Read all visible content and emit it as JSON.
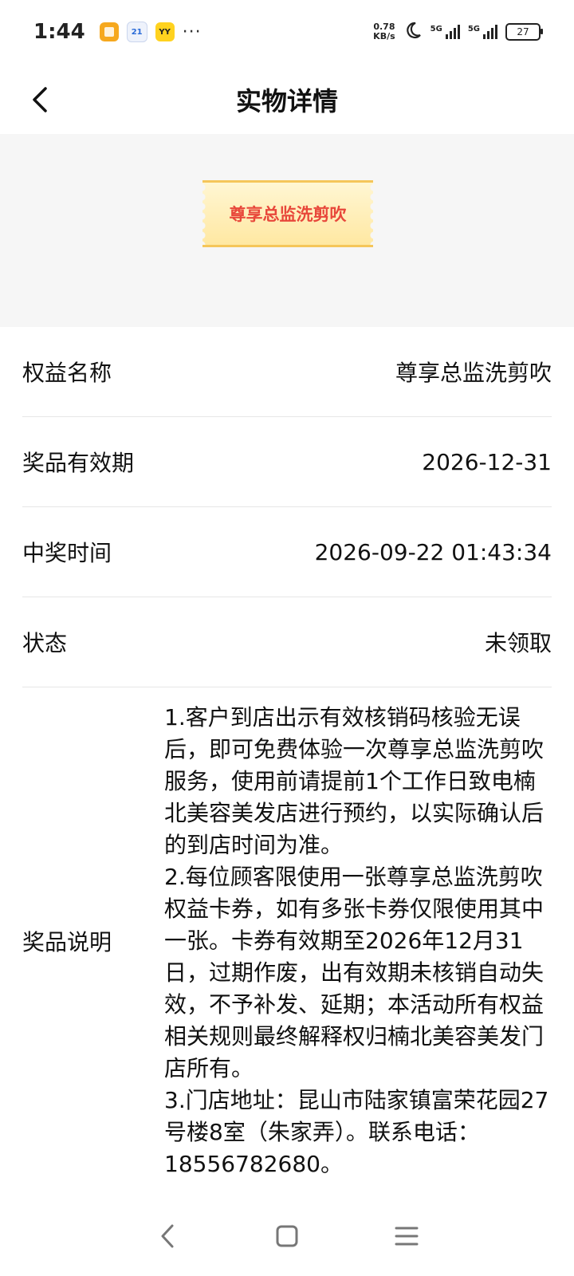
{
  "status_bar": {
    "time": "1:44",
    "notes_icon_text": "",
    "calendar_icon_text": "21",
    "yy_icon_text": "YY",
    "more": "···",
    "speed_value": "0.78",
    "speed_unit": "KB/s",
    "net1": "5G",
    "net2": "5G",
    "battery": "27"
  },
  "navbar": {
    "title": "实物详情",
    "back_icon": "chevron-left-icon"
  },
  "hero": {
    "ticket_text": "尊享总监洗剪吹"
  },
  "details": [
    {
      "label": "权益名称",
      "value": "尊享总监洗剪吹"
    },
    {
      "label": "奖品有效期",
      "value": "2026-12-31"
    },
    {
      "label": "中奖时间",
      "value": "2026-09-22 01:43:34"
    },
    {
      "label": "状态",
      "value": "未领取"
    }
  ],
  "description": {
    "label": "奖品说明",
    "text": "1.客户到店出示有效核销码核验无误后，即可免费体验一次尊享总监洗剪吹服务，使用前请提前1个工作日致电楠北美容美发店进行预约，以实际确认后的到店时间为准。\n2.每位顾客限使用一张尊享总监洗剪吹权益卡券，如有多张卡券仅限使用其中一张。卡券有效期至2026年12月31日，过期作废，出有效期未核销自动失效，不予补发、延期；本活动所有权益相关规则最终解释权归楠北美容美发门店所有。\n3.门店地址：昆山市陆家镇富荣花园27号楼8室（朱家弄）。联系电话：18556782680。"
  },
  "system_nav": {
    "back": "back-icon",
    "home": "home-icon",
    "menu": "menu-icon"
  }
}
